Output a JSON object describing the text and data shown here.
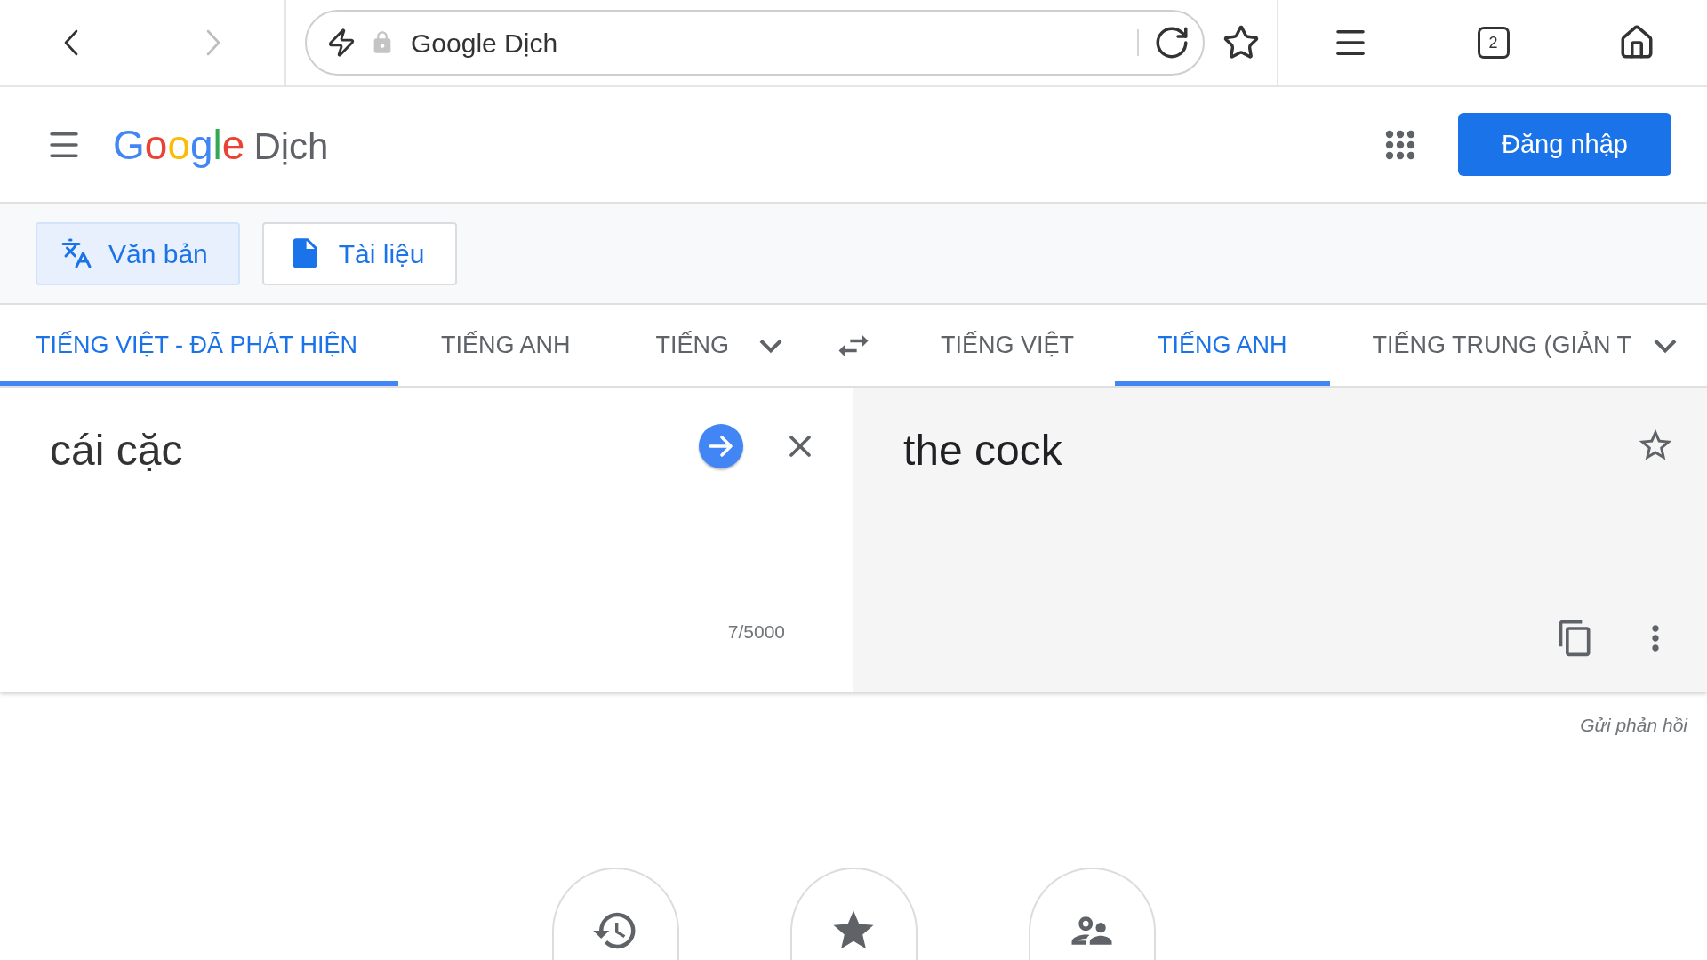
{
  "browser": {
    "nav_buttons": [
      {
        "kind": "back",
        "disabled": false
      },
      {
        "kind": "forward",
        "disabled": true
      }
    ],
    "address": "Google Dịch",
    "tab_count": "2"
  },
  "header": {
    "logo": "Google",
    "product": "Dịch",
    "sign_in": "Đăng nhập"
  },
  "mode_tabs": [
    {
      "kind": "text",
      "label": "Văn bản",
      "selected": true
    },
    {
      "kind": "document",
      "label": "Tài liệu",
      "selected": false
    }
  ],
  "source_languages": [
    {
      "label": "TIẾNG VIỆT - ĐÃ PHÁT HIỆN",
      "selected": true
    },
    {
      "label": "TIẾNG ANH",
      "selected": false
    },
    {
      "label": "TIẾNG",
      "selected": false
    }
  ],
  "target_languages": [
    {
      "label": "TIẾNG VIỆT",
      "selected": false
    },
    {
      "label": "TIẾNG ANH",
      "selected": true
    },
    {
      "label": "TIẾNG TRUNG (GIẢN T",
      "selected": false
    }
  ],
  "source": {
    "text": "cái cặc",
    "char_count": "7/5000"
  },
  "translation": {
    "text": "the cock"
  },
  "feedback_link": "Gửi phản hồi",
  "bottom_actions": [
    {
      "kind": "history"
    },
    {
      "kind": "saved"
    },
    {
      "kind": "community"
    }
  ]
}
